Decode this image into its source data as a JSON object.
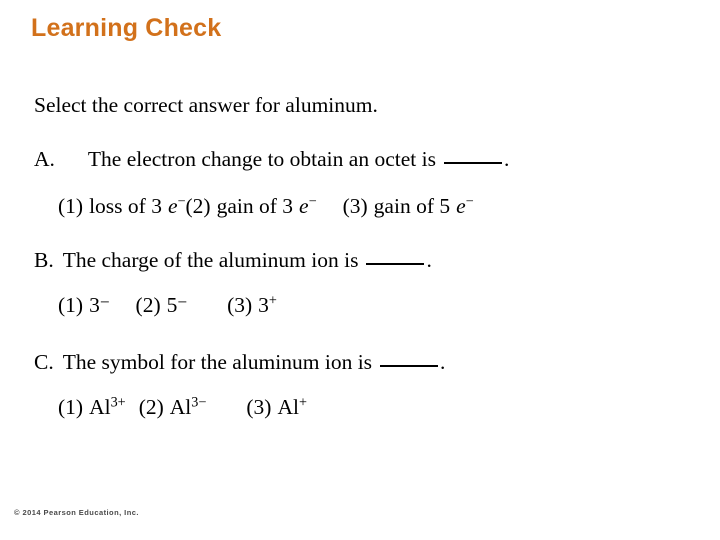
{
  "slide": {
    "title": "Learning Check",
    "title_color": "#D2711B",
    "background_color": "#FFFFFF",
    "text_color": "#000000"
  },
  "stem": {
    "text": "Select the correct answer for aluminum."
  },
  "questions": [
    {
      "label": "A.",
      "text_before_blank": "The electron change to obtain an octet is",
      "blank": "_____",
      "text_after_blank": ".",
      "options": [
        {
          "number": "(1)",
          "text": "loss of 3",
          "symbol": "e",
          "charge": "−"
        },
        {
          "number": "(2)",
          "text": "gain of 3",
          "symbol": "e",
          "charge": "−"
        },
        {
          "number": "(3)",
          "text": "gain of 5",
          "symbol": "e",
          "charge": "−"
        }
      ]
    },
    {
      "label": "B.",
      "text_before_blank": "The charge of the aluminum ion is",
      "blank": "_____",
      "text_after_blank": ".",
      "options": [
        {
          "number": "(1)",
          "value": "3",
          "charge": "−"
        },
        {
          "number": "(2)",
          "value": "5",
          "charge": "−"
        },
        {
          "number": "(3)",
          "value": "3",
          "charge": "+"
        }
      ]
    },
    {
      "label": "C.",
      "text_before_blank": "The symbol for the aluminum ion is",
      "blank": "_____",
      "text_after_blank": ".",
      "options": [
        {
          "number": "(1)",
          "element": "Al",
          "charge": "3+"
        },
        {
          "number": "(2)",
          "element": "Al",
          "charge": "3−"
        },
        {
          "number": "(3)",
          "element": "Al",
          "charge": "+"
        }
      ]
    }
  ],
  "footer": {
    "copyright": "© 2014 Pearson Education, Inc."
  }
}
